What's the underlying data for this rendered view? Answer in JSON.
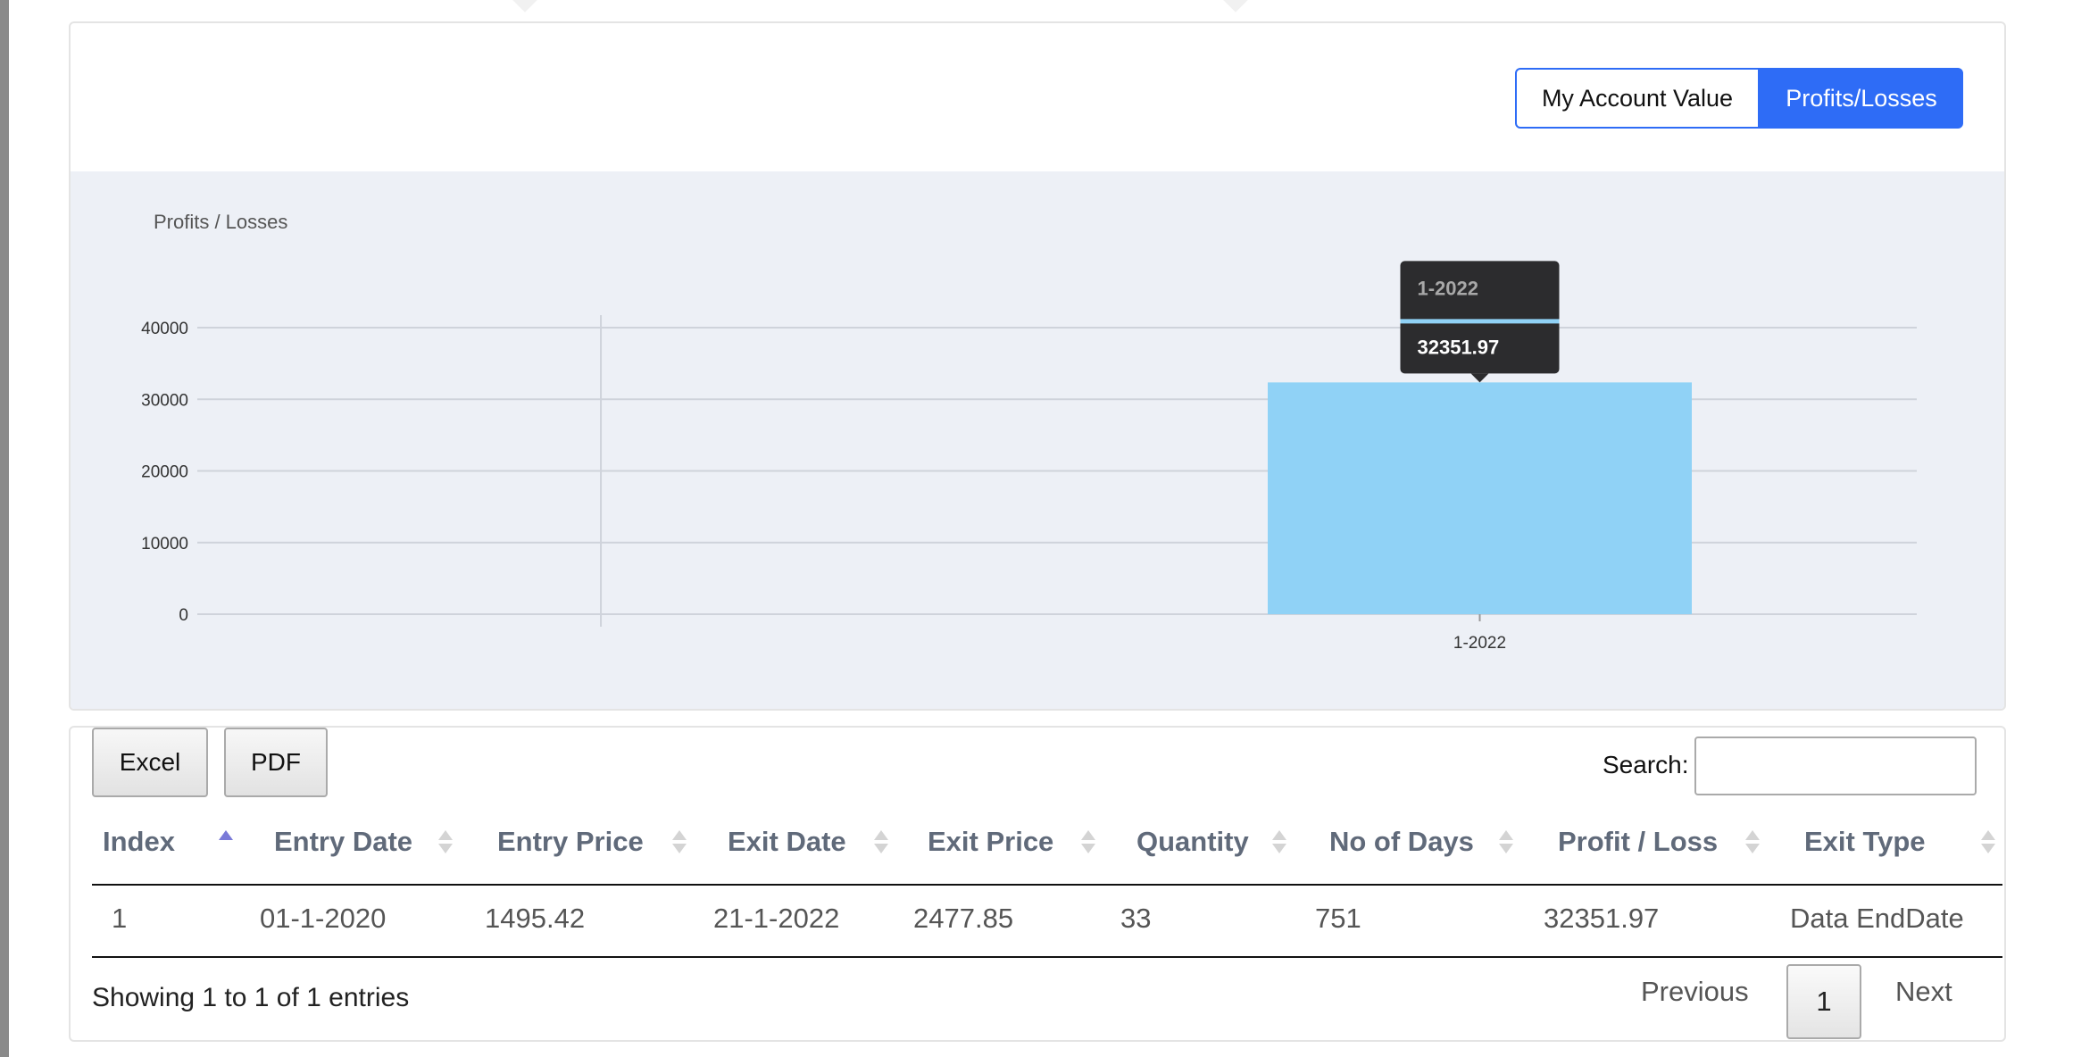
{
  "toggle": {
    "account_value_label": "My Account Value",
    "profits_losses_label": "Profits/Losses"
  },
  "chart_data": {
    "type": "bar",
    "title": "",
    "ylabel": "Profits / Losses",
    "xlabel": "",
    "categories": [
      "1-2022"
    ],
    "values": [
      32351.97
    ],
    "ylim": [
      0,
      40000
    ],
    "yticks": [
      "0",
      "10000",
      "20000",
      "30000",
      "40000"
    ],
    "bar_color": "#90d2f6",
    "grid": true,
    "tooltip": {
      "title": "1-2022",
      "value": "32351.97"
    }
  },
  "table": {
    "export_buttons": {
      "excel": "Excel",
      "pdf": "PDF"
    },
    "search_label": "Search:",
    "search_value": "",
    "columns": [
      "Index",
      "Entry Date",
      "Entry Price",
      "Exit Date",
      "Exit Price",
      "Quantity",
      "No of Days",
      "Profit / Loss",
      "Exit Type"
    ],
    "rows": [
      [
        "1",
        "01-1-2020",
        "1495.42",
        "21-1-2022",
        "2477.85",
        "33",
        "751",
        "32351.97",
        "Data EndDate"
      ]
    ],
    "info": "Showing 1 to 1 of 1 entries",
    "pagination": {
      "previous": "Previous",
      "current": "1",
      "next": "Next"
    }
  }
}
